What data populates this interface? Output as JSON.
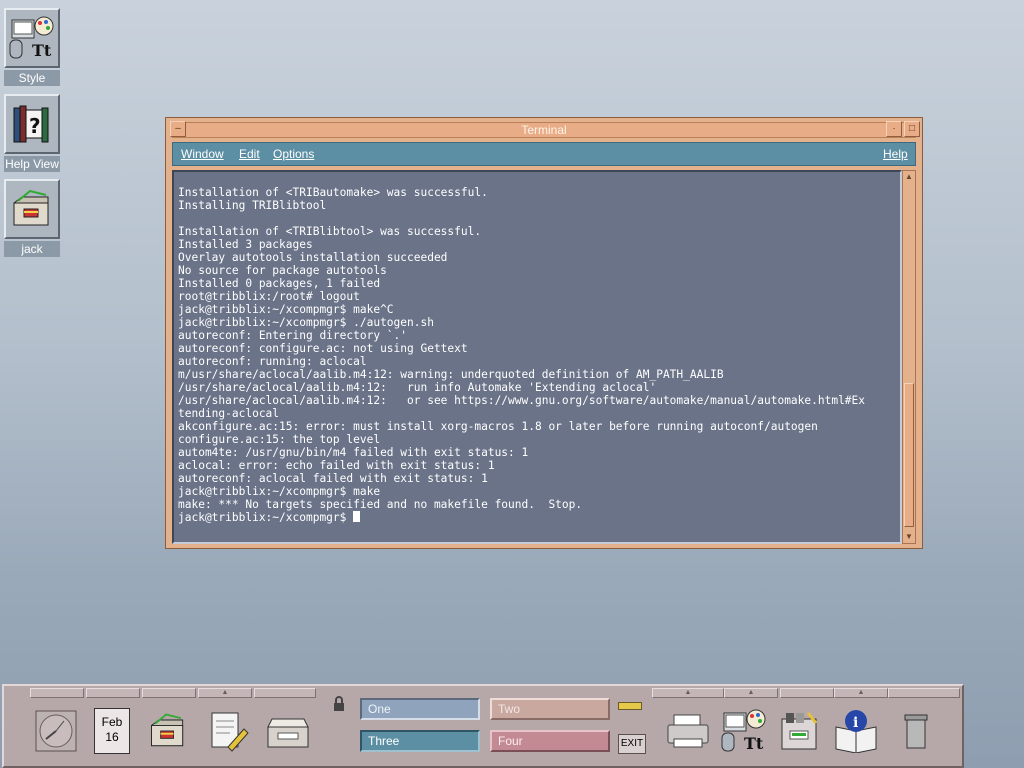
{
  "desktop": {
    "icons": [
      {
        "label": "Style"
      },
      {
        "label": "Help View"
      },
      {
        "label": "jack"
      }
    ]
  },
  "terminal": {
    "title": "Terminal",
    "menu": {
      "window": "Window",
      "edit": "Edit",
      "options": "Options",
      "help": "Help"
    },
    "output": "Installation of <TRIBautomake> was successful.\nInstalling TRIBlibtool\n\nInstallation of <TRIBlibtool> was successful.\nInstalled 3 packages\nOverlay autotools installation succeeded\nNo source for package autotools\nInstalled 0 packages, 1 failed\nroot@tribblix:/root# logout\njack@tribblix:~/xcompmgr$ make^C\njack@tribblix:~/xcompmgr$ ./autogen.sh\nautoreconf: Entering directory `.'\nautoreconf: configure.ac: not using Gettext\nautoreconf: running: aclocal\nm/usr/share/aclocal/aalib.m4:12: warning: underquoted definition of AM_PATH_AALIB\n/usr/share/aclocal/aalib.m4:12:   run info Automake 'Extending aclocal'\n/usr/share/aclocal/aalib.m4:12:   or see https://www.gnu.org/software/automake/manual/automake.html#Ex\ntending-aclocal\nakconfigure.ac:15: error: must install xorg-macros 1.8 or later before running autoconf/autogen\nconfigure.ac:15: the top level\nautom4te: /usr/gnu/bin/m4 failed with exit status: 1\naclocal: error: echo failed with exit status: 1\nautoreconf: aclocal failed with exit status: 1\njack@tribblix:~/xcompmgr$ make\nmake: *** No targets specified and no makefile found.  Stop.\njack@tribblix:~/xcompmgr$ "
  },
  "panel": {
    "calendar": {
      "month": "Feb",
      "day": "16"
    },
    "workspaces": [
      {
        "label": "One",
        "active": false,
        "color": "#8fa4bc"
      },
      {
        "label": "Two",
        "active": false,
        "color": "#c9a8a0"
      },
      {
        "label": "Three",
        "active": true,
        "color": "#5c8fa4"
      },
      {
        "label": "Four",
        "active": false,
        "color": "#c48a94"
      }
    ],
    "exit_label": "EXIT"
  },
  "colors": {
    "window_frame": "#e3b28c",
    "menubar": "#5c8fa4",
    "terminal_bg": "#6a7388",
    "panel": "#b6a8a8"
  }
}
